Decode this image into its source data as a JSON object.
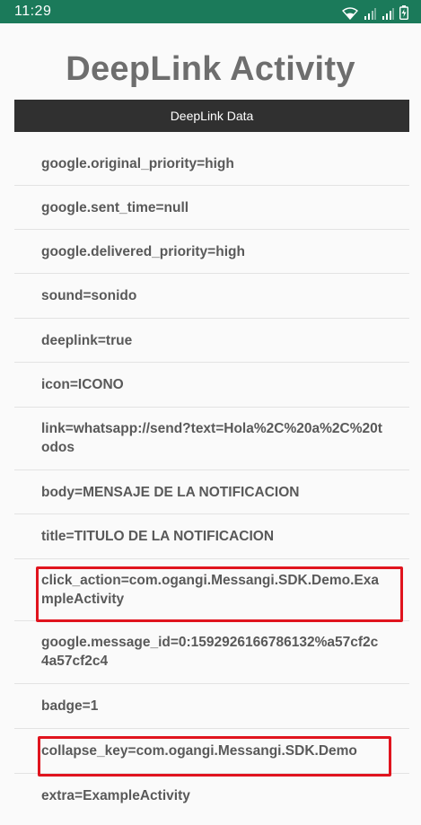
{
  "status_bar": {
    "time": "11:29",
    "icons": [
      "wifi-icon",
      "signal-icon",
      "signal-icon-2",
      "battery-icon"
    ]
  },
  "page_title": "DeepLink Activity",
  "header": {
    "label": "DeepLink Data"
  },
  "items": [
    "google.original_priority=high",
    "google.sent_time=null",
    "google.delivered_priority=high",
    "sound=sonido",
    "deeplink=true",
    "icon=ICONO",
    "link=whatsapp://send?text=Hola%2C%20a%2C%20todos",
    "body=MENSAJE DE LA NOTIFICACION",
    "title=TITULO DE LA NOTIFICACION",
    "click_action=com.ogangi.Messangi.SDK.Demo.ExampleActivity",
    "google.message_id=0:1592926166786132%a57cf2c4a57cf2c4",
    "badge=1",
    "collapse_key=com.ogangi.Messangi.SDK.Demo",
    "extra=ExampleActivity"
  ],
  "highlight_color": "#e0141e",
  "status_bar_color": "#1b7a5a",
  "header_color": "#303030"
}
